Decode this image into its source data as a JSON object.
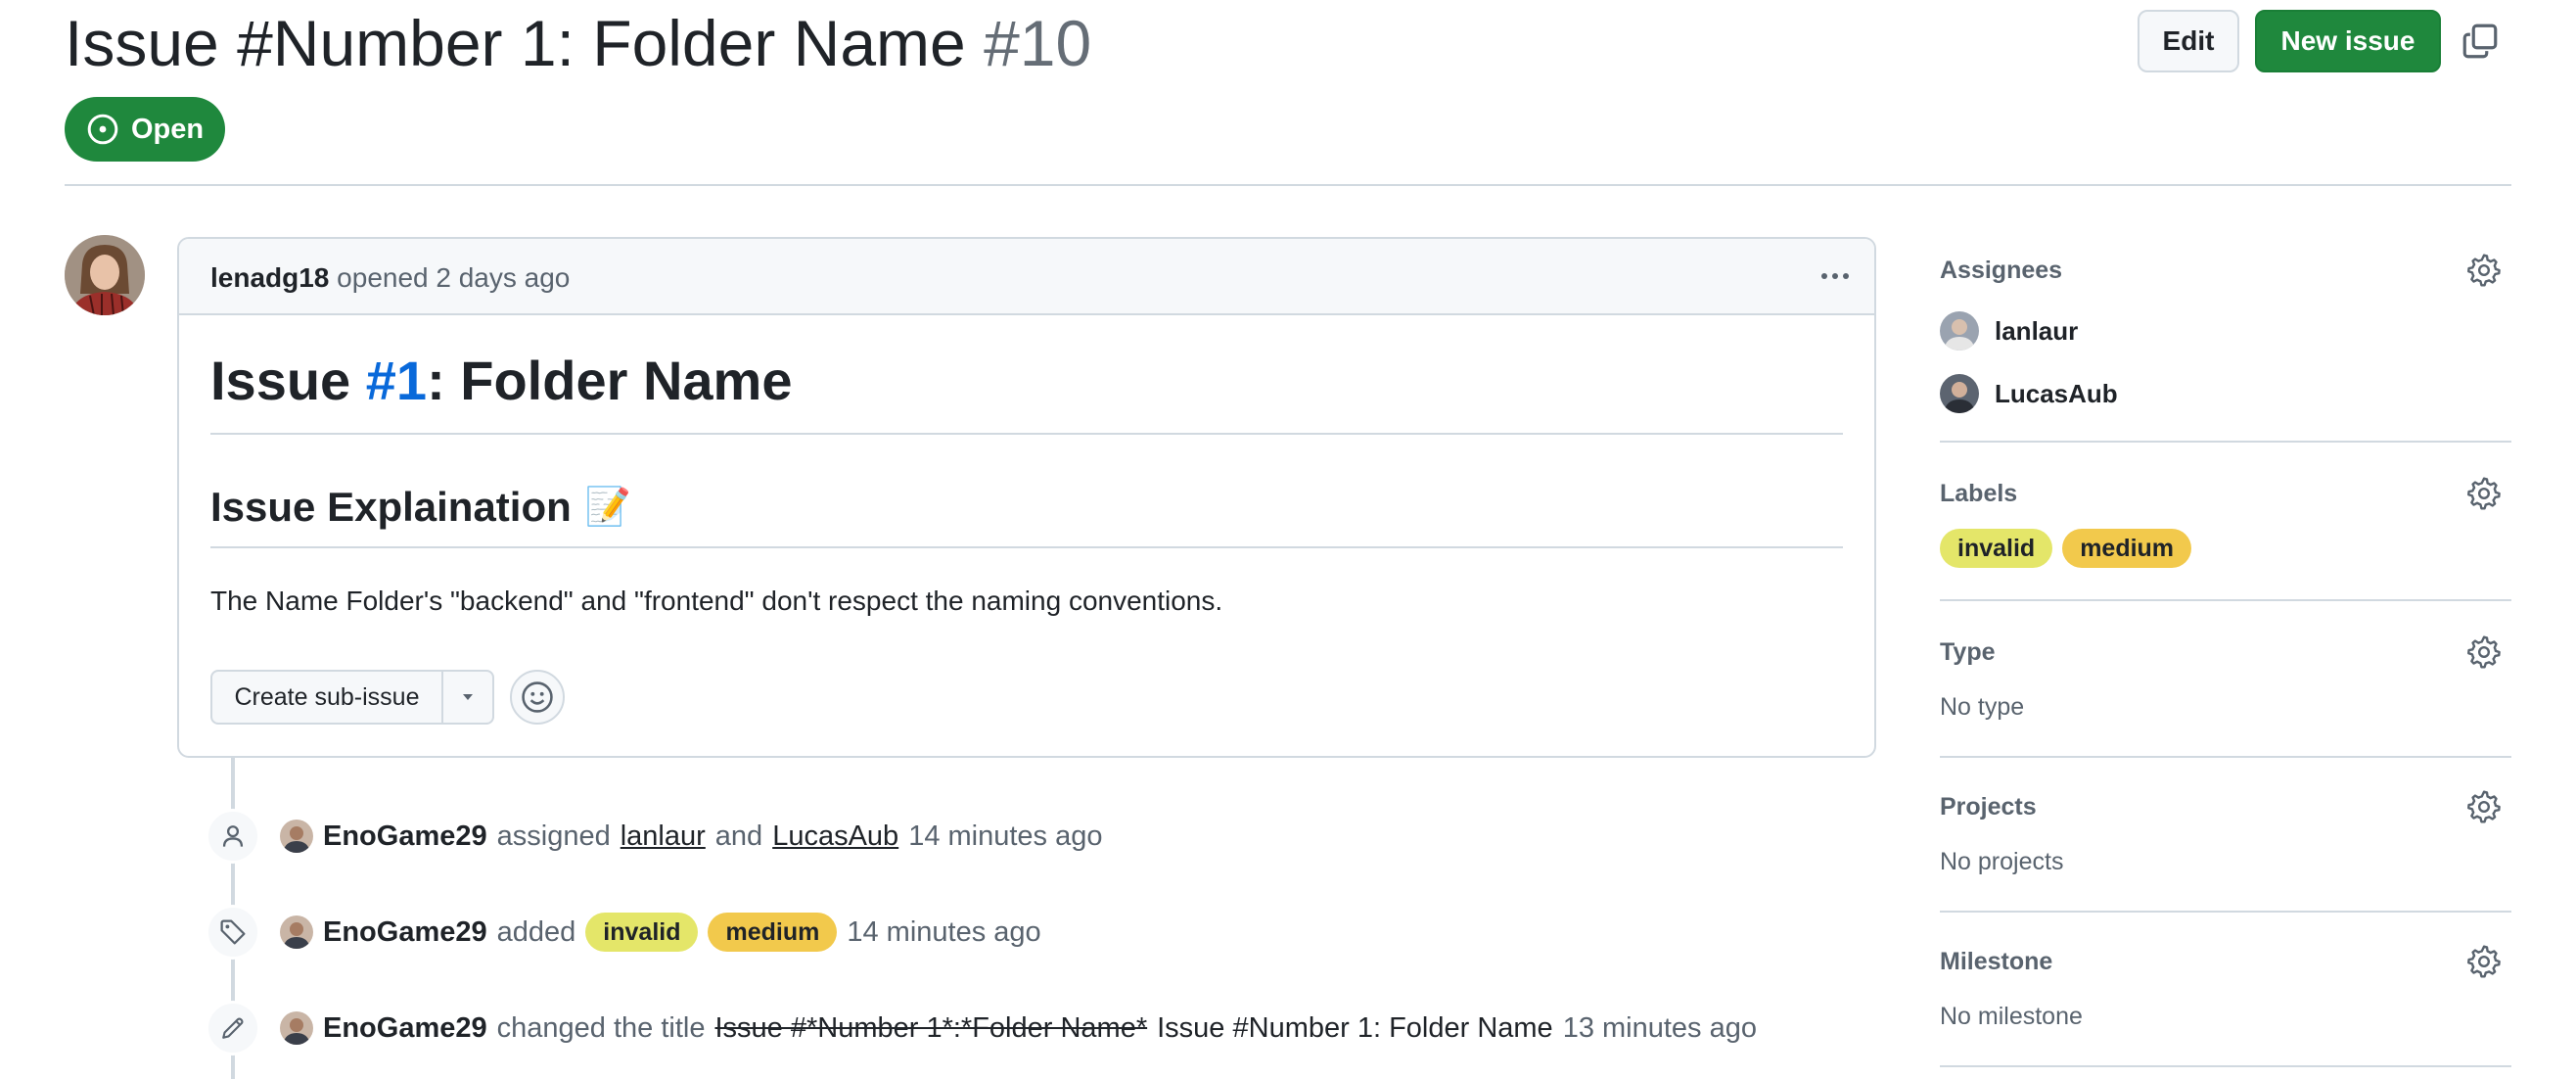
{
  "header": {
    "title": "Issue #Number 1: Folder Name",
    "number": "#10",
    "edit_label": "Edit",
    "new_issue_label": "New issue",
    "state": "Open"
  },
  "comment": {
    "author": "lenadg18",
    "meta": "opened 2 days ago",
    "h1_prefix": "Issue ",
    "h1_ref": "#1",
    "h1_suffix": ": Folder Name",
    "h2": "Issue Explaination",
    "h2_emoji": "📝",
    "paragraph": "The Name Folder's \"backend\" and \"frontend\" don't respect the naming conventions.",
    "sub_issue_label": "Create sub-issue"
  },
  "timeline": {
    "assigned": {
      "actor": "EnoGame29",
      "verb": "assigned",
      "user1": "lanlaur",
      "and": "and",
      "user2": "LucasAub",
      "time": "14 minutes ago"
    },
    "labeled": {
      "actor": "EnoGame29",
      "verb": "added",
      "time": "14 minutes ago"
    },
    "renamed": {
      "actor": "EnoGame29",
      "verb": "changed the title",
      "old_title": "Issue #*Number 1*:*Folder Name*",
      "new_title": "Issue #Number 1: Folder Name",
      "time": "13 minutes ago"
    }
  },
  "labels": [
    {
      "name": "invalid",
      "color": "#e4e669"
    },
    {
      "name": "medium",
      "color": "#f2c94c"
    }
  ],
  "sidebar": {
    "assignees_heading": "Assignees",
    "assignees": [
      "lanlaur",
      "LucasAub"
    ],
    "labels_heading": "Labels",
    "type_heading": "Type",
    "type_value": "No type",
    "projects_heading": "Projects",
    "projects_value": "No projects",
    "milestone_heading": "Milestone",
    "milestone_value": "No milestone"
  },
  "colors": {
    "primary_green": "#1f883d",
    "link_blue": "#0969da",
    "border": "#d1d9e0",
    "muted_text": "#59636e"
  },
  "icons": [
    "copy-icon",
    "issue-open-icon",
    "kebab-menu-icon",
    "triangle-down-icon",
    "smiley-icon",
    "person-icon",
    "tag-icon",
    "pencil-icon",
    "gear-icon"
  ]
}
